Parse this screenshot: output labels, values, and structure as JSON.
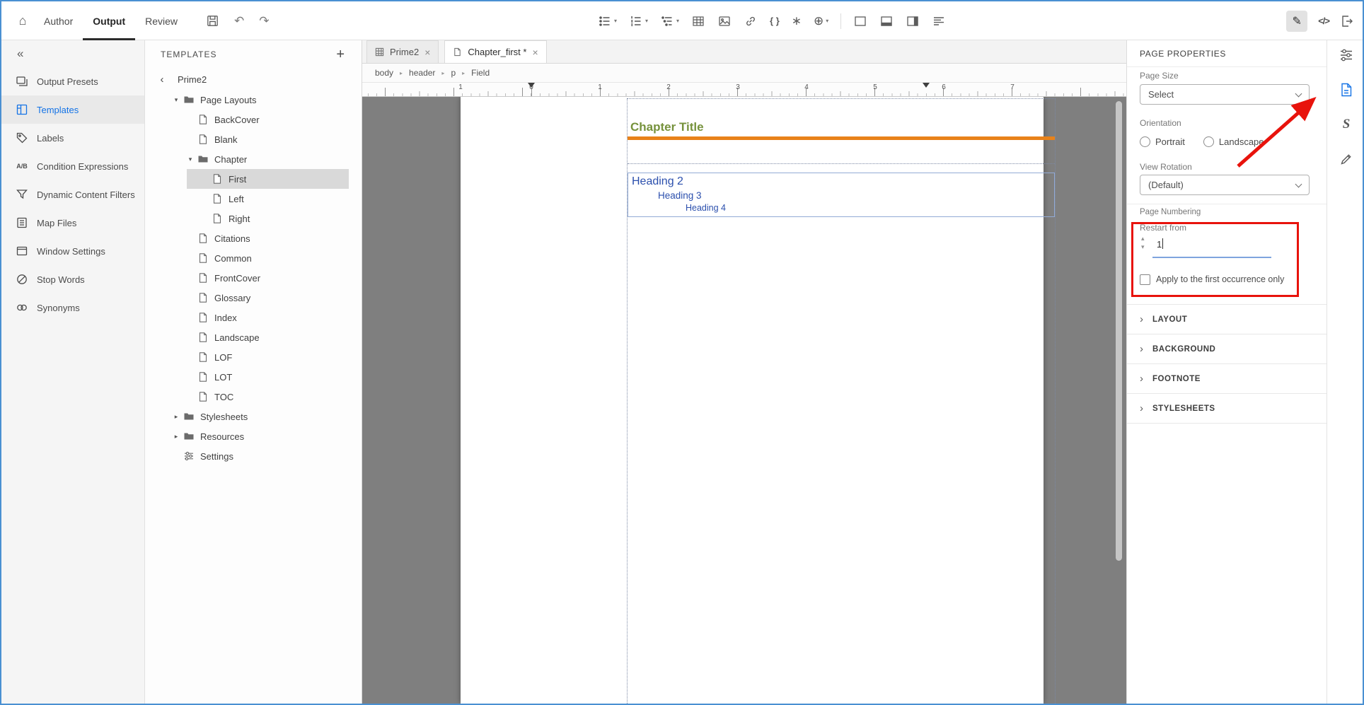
{
  "colors": {
    "accent": "#1473e6",
    "annotation": "#e8130c",
    "chapter_title_green": "#76923c",
    "heading_blue": "#2b4fad",
    "orange_rule": "#e8821a",
    "canvas_gray": "#7f7f7f",
    "window_border_blue": "#4a90d2"
  },
  "glyphs": {
    "home": "⌂",
    "undo": "↶",
    "redo": "↷",
    "pencil": "✎",
    "source": "</>",
    "variable": "{ }",
    "snippet": "∗",
    "insert_more": "⊕",
    "collapse": "«",
    "back": "‹",
    "caret_down": "▾",
    "caret_right": "▸",
    "chevron_right": "›",
    "breadcrumb_sep": "▸",
    "close": "×",
    "add": "+",
    "spin_up": "▴",
    "spin_down": "▾",
    "ab": "A/B"
  },
  "topbar": {
    "nav": [
      {
        "label": "Author",
        "active": false
      },
      {
        "label": "Output",
        "active": true
      },
      {
        "label": "Review",
        "active": false
      }
    ]
  },
  "sidebar": {
    "items": [
      {
        "label": "Output Presets",
        "icon": "output-presets-icon",
        "active": false
      },
      {
        "label": "Templates",
        "icon": "templates-icon",
        "active": true
      },
      {
        "label": "Labels",
        "icon": "labels-icon",
        "active": false
      },
      {
        "label": "Condition Expressions",
        "icon": "condition-expressions-icon",
        "active": false
      },
      {
        "label": "Dynamic Content Filters",
        "icon": "filter-icon",
        "active": false
      },
      {
        "label": "Map Files",
        "icon": "map-files-icon",
        "active": false
      },
      {
        "label": "Window Settings",
        "icon": "window-settings-icon",
        "active": false
      },
      {
        "label": "Stop Words",
        "icon": "stop-words-icon",
        "active": false
      },
      {
        "label": "Synonyms",
        "icon": "synonyms-icon",
        "active": false
      }
    ]
  },
  "templates": {
    "title": "TEMPLATES",
    "root": "Prime2",
    "tree": [
      {
        "label": "Page Layouts",
        "icon": "folder-icon",
        "caret": "down",
        "level": 1
      },
      {
        "label": "BackCover",
        "icon": "page-icon",
        "level": 2
      },
      {
        "label": "Blank",
        "icon": "page-icon",
        "level": 2
      },
      {
        "label": "Chapter",
        "icon": "folder-icon",
        "caret": "down",
        "level": 2
      },
      {
        "label": "First",
        "icon": "page-icon",
        "level": 3,
        "selected": true
      },
      {
        "label": "Left",
        "icon": "page-icon",
        "level": 3
      },
      {
        "label": "Right",
        "icon": "page-icon",
        "level": 3
      },
      {
        "label": "Citations",
        "icon": "page-icon",
        "level": 2
      },
      {
        "label": "Common",
        "icon": "page-icon",
        "level": 2
      },
      {
        "label": "FrontCover",
        "icon": "page-icon",
        "level": 2
      },
      {
        "label": "Glossary",
        "icon": "page-icon",
        "level": 2
      },
      {
        "label": "Index",
        "icon": "page-icon",
        "level": 2
      },
      {
        "label": "Landscape",
        "icon": "page-icon",
        "level": 2
      },
      {
        "label": "LOF",
        "icon": "page-icon",
        "level": 2
      },
      {
        "label": "LOT",
        "icon": "page-icon",
        "level": 2
      },
      {
        "label": "TOC",
        "icon": "page-icon",
        "level": 2
      },
      {
        "label": "Stylesheets",
        "icon": "folder-icon",
        "caret": "right",
        "level": 1
      },
      {
        "label": "Resources",
        "icon": "folder-icon",
        "caret": "right",
        "level": 1
      },
      {
        "label": "Settings",
        "icon": "settings-icon",
        "level": 1
      }
    ]
  },
  "editor": {
    "tabs": [
      {
        "label": "Prime2",
        "active": false
      },
      {
        "label": "Chapter_first *",
        "active": true
      }
    ],
    "breadcrumb": [
      "body",
      "header",
      "p",
      "Field"
    ],
    "ruler": {
      "numbers": [
        "1",
        "0",
        "1",
        "2",
        "3",
        "4",
        "5",
        "6",
        "7"
      ]
    },
    "page": {
      "chapter_title": "Chapter Title",
      "headings": [
        "Heading 2",
        "Heading 3",
        "Heading 4"
      ]
    }
  },
  "properties": {
    "title": "PAGE PROPERTIES",
    "page_size": {
      "label": "Page Size",
      "value": "Select"
    },
    "orientation": {
      "label": "Orientation",
      "options": [
        "Portrait",
        "Landscape"
      ],
      "selected": ""
    },
    "view_rotation": {
      "label": "View Rotation",
      "value": "(Default)"
    },
    "page_numbering": {
      "label": "Page Numbering",
      "restart_label": "Restart from",
      "restart_value": "1",
      "checkbox_label": "Apply to the first occurrence only",
      "checkbox_checked": false
    },
    "sections": [
      "LAYOUT",
      "BACKGROUND",
      "FOOTNOTE",
      "STYLESHEETS"
    ]
  },
  "right_rail": {
    "icons": [
      "content-properties-icon",
      "page-properties-icon",
      "styles-icon",
      "review-pen-icon"
    ],
    "active": "page-properties-icon",
    "styles_letter": "S"
  }
}
